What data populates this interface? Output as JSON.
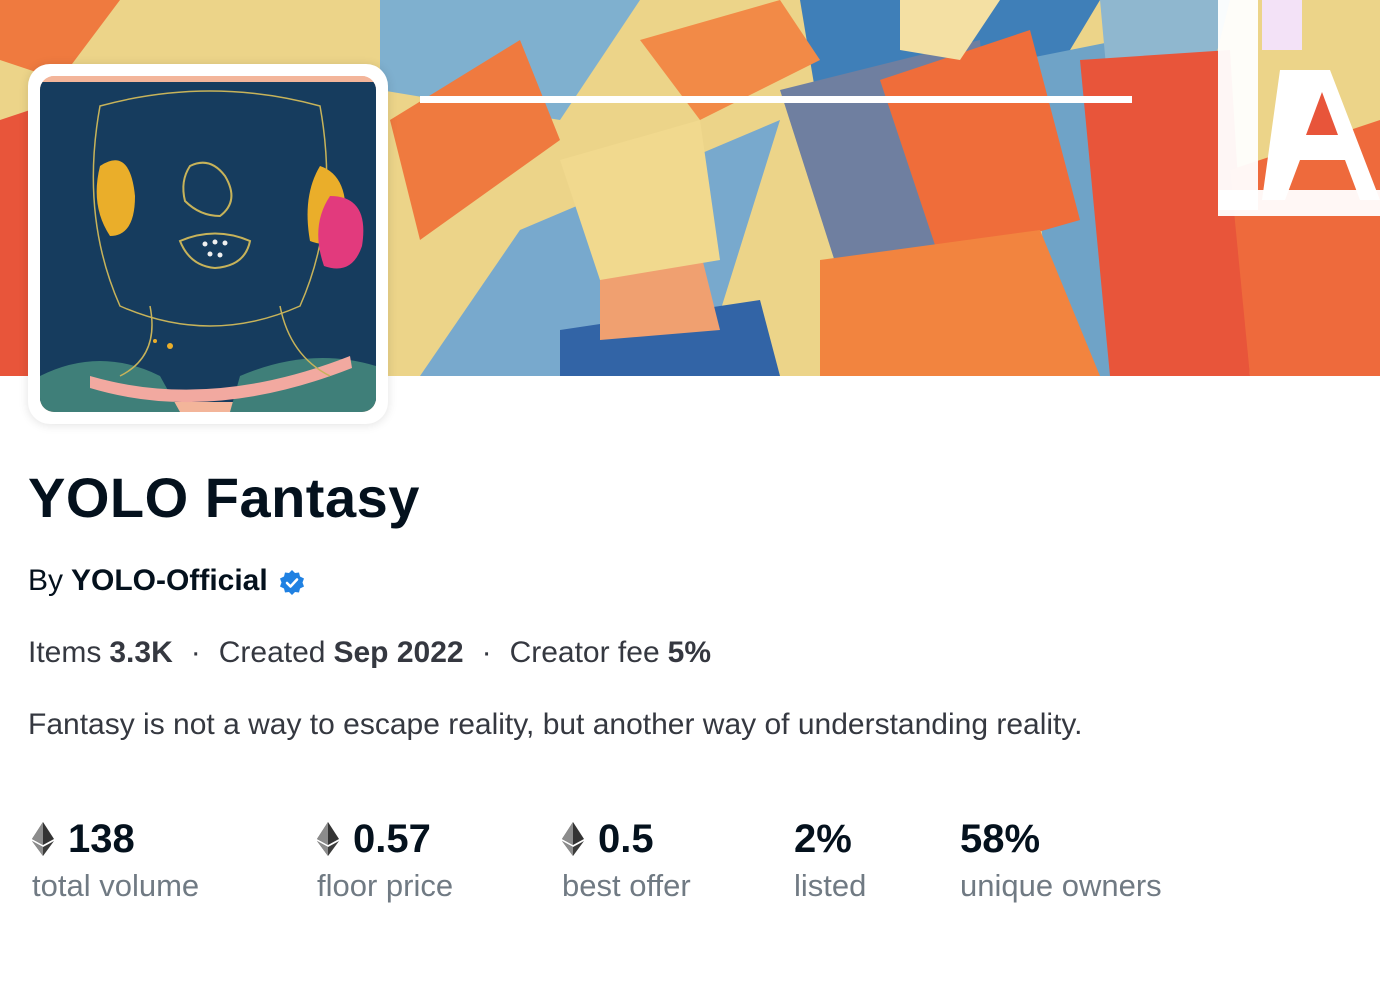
{
  "collection": {
    "name": "YOLO Fantasy",
    "by_prefix": "By",
    "creator": "YOLO-Official",
    "verified_icon": "verified-badge-icon",
    "description": "Fantasy is not a way to escape reality, but another way of understanding reality."
  },
  "meta": {
    "items_label": "Items",
    "items_value": "3.3K",
    "created_label": "Created",
    "created_value": "Sep 2022",
    "fee_label": "Creator fee",
    "fee_value": "5%",
    "separator": "·"
  },
  "stats": [
    {
      "value": "138",
      "label": "total volume",
      "icon": "ethereum-icon"
    },
    {
      "value": "0.57",
      "label": "floor price",
      "icon": "ethereum-icon"
    },
    {
      "value": "0.5",
      "label": "best offer",
      "icon": "ethereum-icon"
    },
    {
      "value": "2%",
      "label": "listed"
    },
    {
      "value": "58%",
      "label": "unique owners"
    }
  ],
  "colors": {
    "text_primary": "#04111d",
    "text_secondary": "#707a83",
    "verified": "#2081e2",
    "banner_orange": "#ee6a3c",
    "banner_blue": "#5e93b8",
    "banner_yellow": "#ecd489",
    "avatar_navy": "#1b3a5c"
  }
}
